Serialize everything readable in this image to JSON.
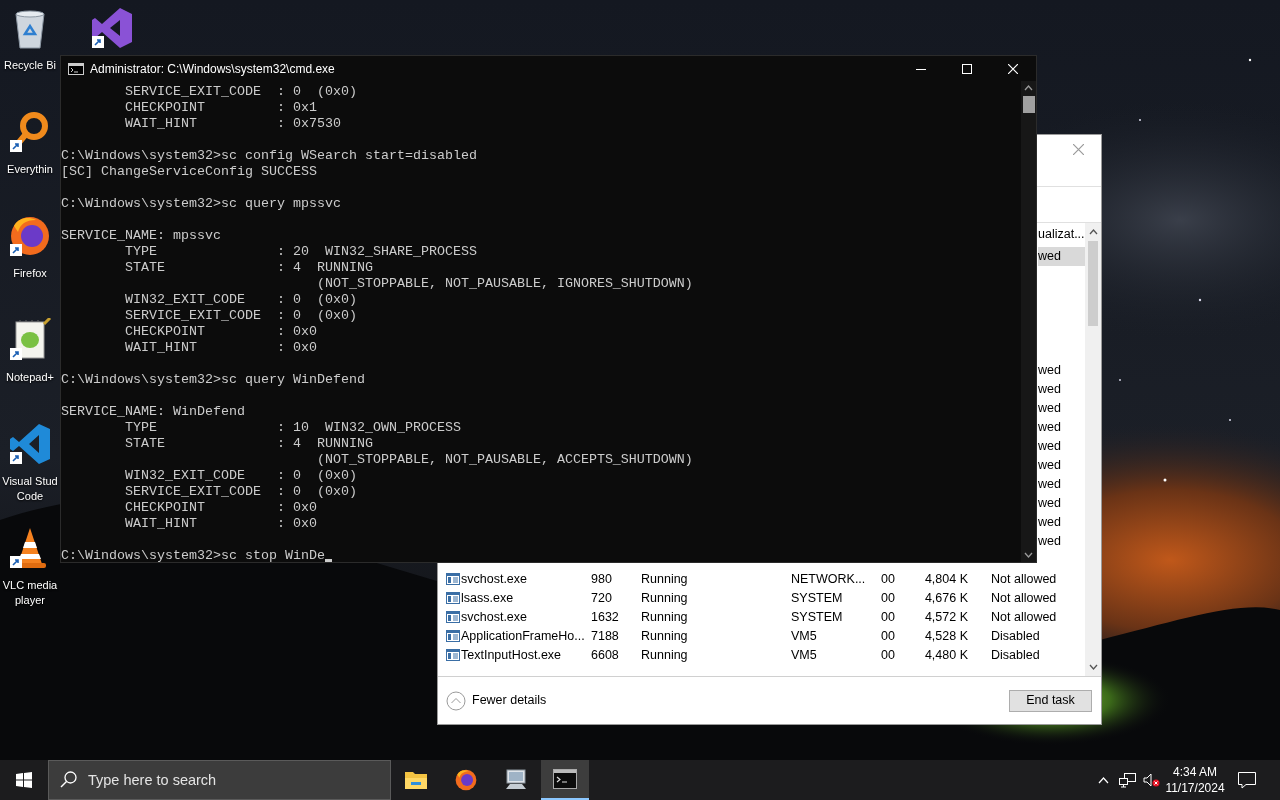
{
  "desktop": {
    "icons": [
      {
        "kind": "recycle-bin",
        "lines": [
          "Recycle Bi"
        ]
      },
      {
        "kind": "magnifier",
        "lines": [
          "Everythin"
        ]
      },
      {
        "kind": "fox-globe",
        "lines": [
          "Firefox"
        ]
      },
      {
        "kind": "notepad",
        "lines": [
          "Notepad+"
        ]
      },
      {
        "kind": "angle-ribbon",
        "lines": [
          "Visual Stud",
          "Code"
        ]
      },
      {
        "kind": "traffic-cone",
        "lines": [
          "VLC media",
          "player"
        ]
      }
    ],
    "partly_hidden_icons": [
      {
        "kind": "ribbon"
      }
    ]
  },
  "task_manager": {
    "header_fragment": "ualizat...",
    "rows": [
      {
        "kind": "covered",
        "selected": true,
        "fragment": "wed"
      },
      {
        "kind": "covered",
        "selected": false
      },
      {
        "kind": "covered",
        "selected": false
      },
      {
        "kind": "covered",
        "selected": false
      },
      {
        "kind": "covered",
        "selected": false
      },
      {
        "kind": "covered",
        "selected": false
      },
      {
        "kind": "covered",
        "selected": false,
        "fragment": "wed"
      },
      {
        "kind": "covered",
        "selected": false,
        "fragment": "wed"
      },
      {
        "kind": "covered",
        "selected": false,
        "fragment": "wed"
      },
      {
        "kind": "covered",
        "selected": false,
        "fragment": "wed"
      },
      {
        "kind": "covered",
        "selected": false,
        "fragment": "wed"
      },
      {
        "kind": "covered",
        "selected": false,
        "fragment": "wed"
      },
      {
        "kind": "covered",
        "selected": false,
        "fragment": "wed"
      },
      {
        "kind": "covered",
        "selected": false,
        "fragment": "wed"
      },
      {
        "kind": "covered",
        "selected": false,
        "fragment": "wed"
      },
      {
        "kind": "covered",
        "selected": false,
        "fragment": "wed"
      },
      {
        "kind": "covered",
        "selected": false
      },
      {
        "kind": "full",
        "selected": false,
        "name": "svchost.exe",
        "pid": "980",
        "status": "Running",
        "user": "NETWORK...",
        "cpu": "00",
        "memory": "4,804 K",
        "uac": "Not allowed"
      },
      {
        "kind": "full",
        "selected": false,
        "name": "lsass.exe",
        "pid": "720",
        "status": "Running",
        "user": "SYSTEM",
        "cpu": "00",
        "memory": "4,676 K",
        "uac": "Not allowed"
      },
      {
        "kind": "full",
        "selected": false,
        "name": "svchost.exe",
        "pid": "1632",
        "status": "Running",
        "user": "SYSTEM",
        "cpu": "00",
        "memory": "4,572 K",
        "uac": "Not allowed"
      },
      {
        "kind": "full",
        "selected": false,
        "name": "ApplicationFrameHo...",
        "pid": "7188",
        "status": "Running",
        "user": "VM5",
        "cpu": "00",
        "memory": "4,528 K",
        "uac": "Disabled"
      },
      {
        "kind": "full",
        "selected": false,
        "name": "TextInputHost.exe",
        "pid": "6608",
        "status": "Running",
        "user": "VM5",
        "cpu": "00",
        "memory": "4,480 K",
        "uac": "Disabled"
      }
    ],
    "footer": {
      "toggle": "Fewer details",
      "button": "End task"
    }
  },
  "console": {
    "title": "Administrator: C:\\Windows\\system32\\cmd.exe",
    "blocks": [
      [
        "        SERVICE_EXIT_CODE  : 0  (0x0)",
        "        CHECKPOINT         : 0x1",
        "        WAIT_HINT          : 0x7530"
      ],
      [
        "C:\\Windows\\system32>sc config WSearch start=disabled",
        "[SC] ChangeServiceConfig SUCCESS"
      ],
      [
        "C:\\Windows\\system32>sc query mpssvc"
      ],
      [
        "SERVICE_NAME: mpssvc",
        "        TYPE               : 20  WIN32_SHARE_PROCESS",
        "        STATE              : 4  RUNNING",
        "                                (NOT_STOPPABLE, NOT_PAUSABLE, IGNORES_SHUTDOWN)",
        "        WIN32_EXIT_CODE    : 0  (0x0)",
        "        SERVICE_EXIT_CODE  : 0  (0x0)",
        "        CHECKPOINT         : 0x0",
        "        WAIT_HINT          : 0x0"
      ],
      [
        "C:\\Windows\\system32>sc query WinDefend"
      ],
      [
        "SERVICE_NAME: WinDefend",
        "        TYPE               : 10  WIN32_OWN_PROCESS",
        "        STATE              : 4  RUNNING",
        "                                (NOT_STOPPABLE, NOT_PAUSABLE, ACCEPTS_SHUTDOWN)",
        "        WIN32_EXIT_CODE    : 0  (0x0)",
        "        SERVICE_EXIT_CODE  : 0  (0x0)",
        "        CHECKPOINT         : 0x0",
        "        WAIT_HINT          : 0x0"
      ],
      [
        "C:\\Windows\\system32>sc stop WinDe"
      ]
    ]
  },
  "taskbar": {
    "search": {
      "placeholder": "Type here to search"
    },
    "apps": [
      {
        "kind": "folder",
        "selected": false
      },
      {
        "kind": "fox-globe",
        "selected": false
      },
      {
        "kind": "computer",
        "selected": false
      },
      {
        "kind": "terminal",
        "selected": true
      }
    ],
    "clock": {
      "time": "4:34 AM",
      "date": "11/17/2024"
    }
  }
}
